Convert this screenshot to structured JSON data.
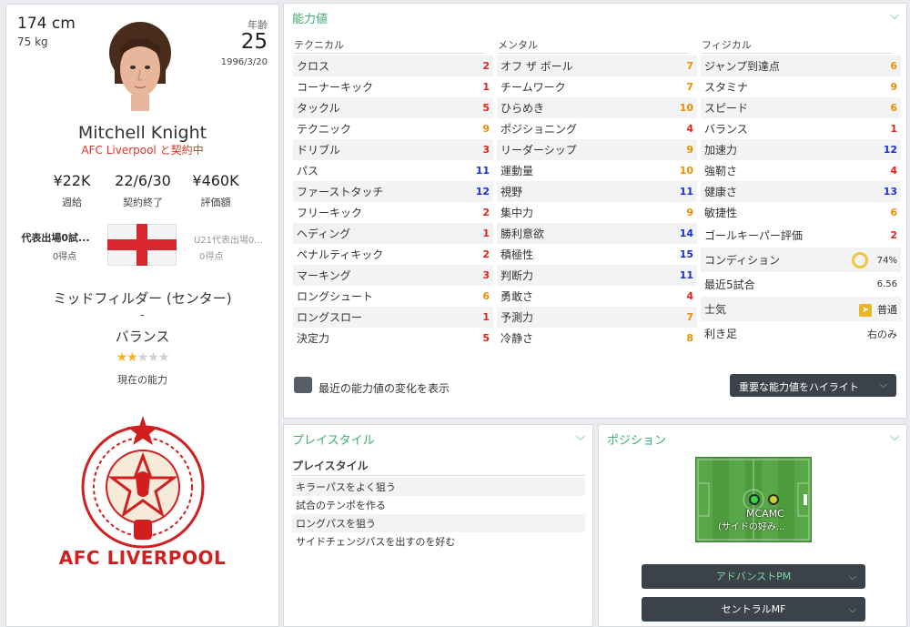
{
  "profile": {
    "height": "174 cm",
    "weight": "75 kg",
    "age_label": "年齢",
    "age": "25",
    "dob": "1996/3/20",
    "name": "Mitchell Knight",
    "contract_status": "AFC Liverpool と契約中",
    "wage": "¥22K",
    "wage_label": "週給",
    "contract_end": "22/6/30",
    "contract_end_label": "契約終了",
    "value": "¥460K",
    "value_label": "評価額",
    "intl_caps": "代表出場0試...",
    "intl_goals": "0得点",
    "u21_caps": "U21代表出場0...",
    "u21_goals": "0得点",
    "position": "ミッドフィルダー (センター)",
    "dash": "-",
    "role": "バランス",
    "stars": 1.5,
    "ability_label": "現在の能力",
    "club_name": "AFC LIVERPOOL"
  },
  "attributes": {
    "title": "能力値",
    "technical_header": "テクニカル",
    "mental_header": "メンタル",
    "physical_header": "フィジカル",
    "technical": [
      {
        "name": "クロス",
        "value": "2",
        "color": "#e0241b"
      },
      {
        "name": "コーナーキック",
        "value": "1",
        "color": "#e0241b"
      },
      {
        "name": "タックル",
        "value": "5",
        "color": "#e0241b"
      },
      {
        "name": "テクニック",
        "value": "9",
        "color": "#f08c00"
      },
      {
        "name": "ドリブル",
        "value": "3",
        "color": "#e0241b"
      },
      {
        "name": "パス",
        "value": "11",
        "color": "#1a2fd6"
      },
      {
        "name": "ファーストタッチ",
        "value": "12",
        "color": "#1a2fd6"
      },
      {
        "name": "フリーキック",
        "value": "2",
        "color": "#e0241b"
      },
      {
        "name": "ヘディング",
        "value": "1",
        "color": "#e0241b"
      },
      {
        "name": "ペナルティキック",
        "value": "2",
        "color": "#e0241b"
      },
      {
        "name": "マーキング",
        "value": "3",
        "color": "#e0241b"
      },
      {
        "name": "ロングシュート",
        "value": "6",
        "color": "#f08c00"
      },
      {
        "name": "ロングスロー",
        "value": "1",
        "color": "#e0241b"
      },
      {
        "name": "決定力",
        "value": "5",
        "color": "#e0241b"
      }
    ],
    "mental": [
      {
        "name": "オフ ザ ボール",
        "value": "7",
        "color": "#f08c00"
      },
      {
        "name": "チームワーク",
        "value": "7",
        "color": "#f08c00"
      },
      {
        "name": "ひらめき",
        "value": "10",
        "color": "#f08c00"
      },
      {
        "name": "ポジショニング",
        "value": "4",
        "color": "#e0241b"
      },
      {
        "name": "リーダーシップ",
        "value": "9",
        "color": "#f08c00"
      },
      {
        "name": "運動量",
        "value": "10",
        "color": "#f08c00"
      },
      {
        "name": "視野",
        "value": "11",
        "color": "#1a2fd6"
      },
      {
        "name": "集中力",
        "value": "9",
        "color": "#f08c00"
      },
      {
        "name": "勝利意欲",
        "value": "14",
        "color": "#1a2fd6"
      },
      {
        "name": "積極性",
        "value": "15",
        "color": "#1a2fd6"
      },
      {
        "name": "判断力",
        "value": "11",
        "color": "#1a2fd6"
      },
      {
        "name": "勇敢さ",
        "value": "4",
        "color": "#e0241b"
      },
      {
        "name": "予測力",
        "value": "7",
        "color": "#f08c00"
      },
      {
        "name": "冷静さ",
        "value": "8",
        "color": "#f08c00"
      }
    ],
    "physical": [
      {
        "name": "ジャンプ到達点",
        "value": "6",
        "color": "#f08c00"
      },
      {
        "name": "スタミナ",
        "value": "9",
        "color": "#f08c00"
      },
      {
        "name": "スピード",
        "value": "6",
        "color": "#f08c00"
      },
      {
        "name": "バランス",
        "value": "1",
        "color": "#e0241b"
      },
      {
        "name": "加速力",
        "value": "12",
        "color": "#1a2fd6"
      },
      {
        "name": "強靭さ",
        "value": "4",
        "color": "#e0241b"
      },
      {
        "name": "健康さ",
        "value": "13",
        "color": "#1a2fd6"
      },
      {
        "name": "敏捷性",
        "value": "6",
        "color": "#f08c00"
      }
    ],
    "gk_rating_label": "ゴールキーパー評価",
    "gk_rating": "2",
    "condition_label": "コンディション",
    "condition": "74%",
    "last5_label": "最近5試合",
    "last5": "6.56",
    "morale_label": "士気",
    "morale": "普通",
    "foot_label": "利き足",
    "foot": "右のみ",
    "recent_changes_label": "最近の能力値の変化を表示",
    "highlight_button": "重要な能力値をハイライト"
  },
  "playstyle": {
    "title": "プレイスタイル",
    "subtitle": "プレイスタイル",
    "traits": [
      "キラーパスをよく狙う",
      "試合のテンポを作る",
      "ロングパスを狙う",
      "サイドチェンジパスを出すのを好む"
    ]
  },
  "positions": {
    "title": "ポジション",
    "label": "MCAMC",
    "sublabel": "(サイドの好み...",
    "role1": "アドバンストPM",
    "role2": "セントラルMF"
  },
  "colors": {
    "accent": "#3bb06f",
    "red": "#e0241b",
    "orange": "#f08c00",
    "blue": "#1a2fd6"
  }
}
